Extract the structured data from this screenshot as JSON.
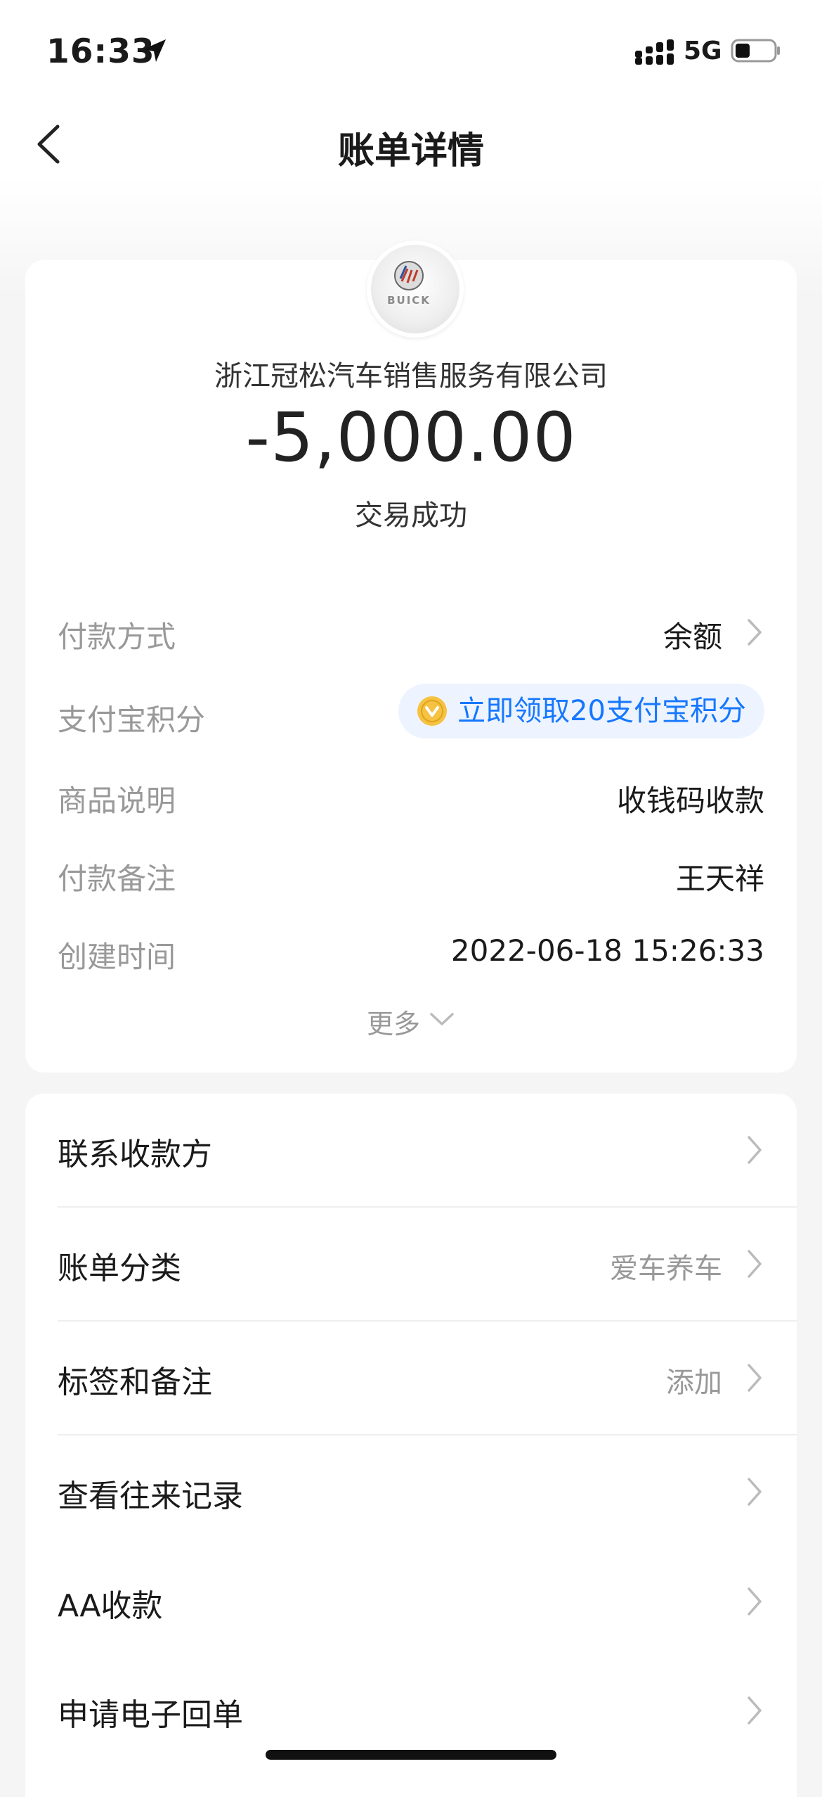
{
  "status_bar": {
    "time": "16:33",
    "network": "5G",
    "icons": [
      "location-arrow-icon",
      "signal-icon",
      "battery-icon"
    ]
  },
  "nav": {
    "title": "账单详情",
    "back_icon": "chevron-left-icon"
  },
  "summary": {
    "merchant_logo": "BUICK",
    "merchant": "浙江冠松汽车销售服务有限公司",
    "amount": "-5,000.00",
    "status": "交易成功"
  },
  "details": [
    {
      "label": "付款方式",
      "value": "余额"
    },
    {
      "label": "支付宝积分",
      "value": "立即领取20支付宝积分"
    },
    {
      "label": "商品说明",
      "value": "收钱码收款"
    },
    {
      "label": "付款备注",
      "value": "王天祥"
    },
    {
      "label": "创建时间",
      "value": "2022-06-18 15:26:33"
    }
  ],
  "more_label": "更多",
  "menu": [
    {
      "label": "联系收款方",
      "value": ""
    },
    {
      "label": "账单分类",
      "value": "爱车养车"
    },
    {
      "label": "标签和备注",
      "value": "添加"
    },
    {
      "label": "查看往来记录",
      "value": ""
    },
    {
      "label": "AA收款",
      "value": ""
    },
    {
      "label": "申请电子回单",
      "value": ""
    }
  ],
  "colors": {
    "accent": "#1677ff",
    "accent_bg": "#edf4ff",
    "coin": "#f5c242",
    "label_gray": "#999999",
    "background": "#f5f5f5"
  }
}
